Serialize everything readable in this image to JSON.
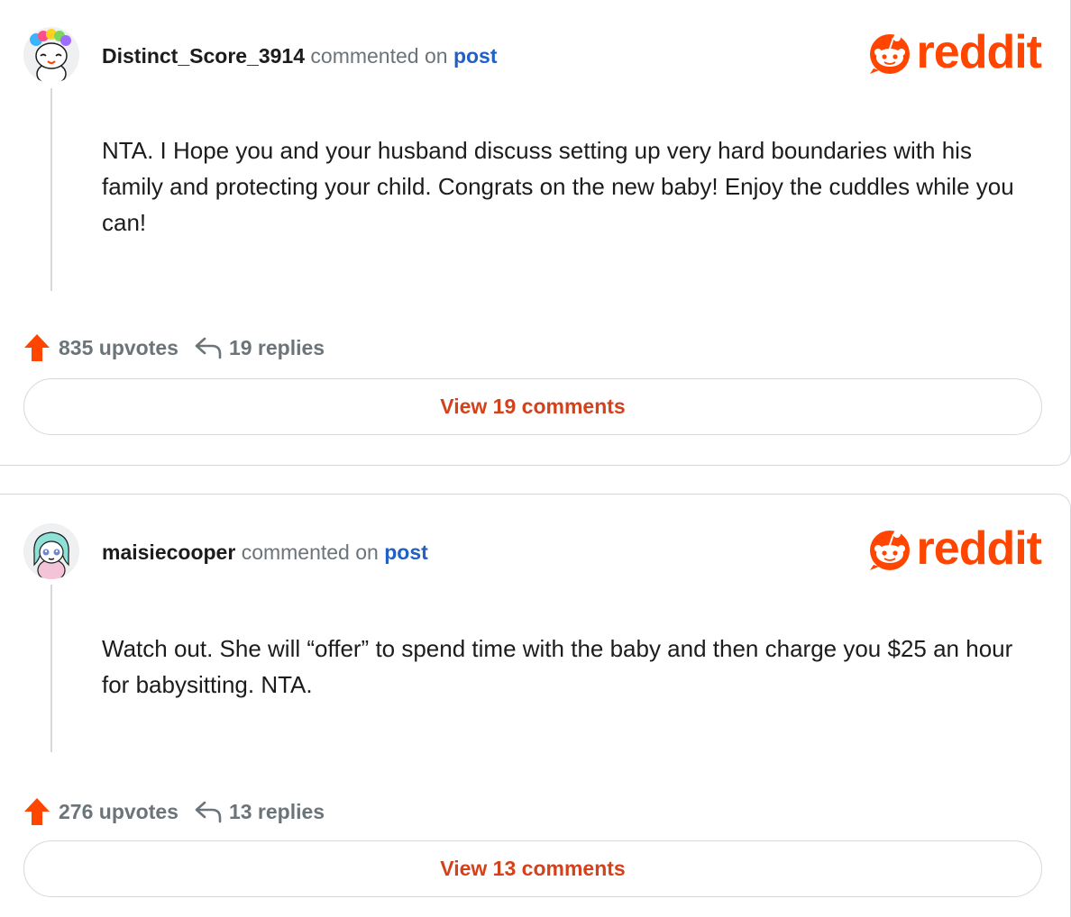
{
  "comments": [
    {
      "username": "Distinct_Score_3914",
      "action_text": "commented on",
      "post_link": "post",
      "logo_text": "reddit",
      "body": "NTA. I Hope you and your husband discuss setting up very hard boundaries with his family and protecting your child. Congrats on the new baby! Enjoy the cuddles while you can!",
      "upvotes": "835 upvotes",
      "replies": "19 replies",
      "view_button": "View 19 comments",
      "avatar": "snoo-avatar-rainbow-hair"
    },
    {
      "username": "maisiecooper",
      "action_text": "commented on",
      "post_link": "post",
      "logo_text": "reddit",
      "body": "Watch out. She will “offer” to spend time with the baby and then charge you $25 an hour for babysitting. NTA.",
      "upvotes": "276 upvotes",
      "replies": "13 replies",
      "view_button": "View 13 comments",
      "avatar": "snoo-avatar-teal-hair"
    }
  ],
  "colors": {
    "brand": "#ff4500",
    "link": "#2160c4",
    "muted": "#6b7479",
    "button_text": "#d4411a",
    "border": "#d6d8da"
  }
}
